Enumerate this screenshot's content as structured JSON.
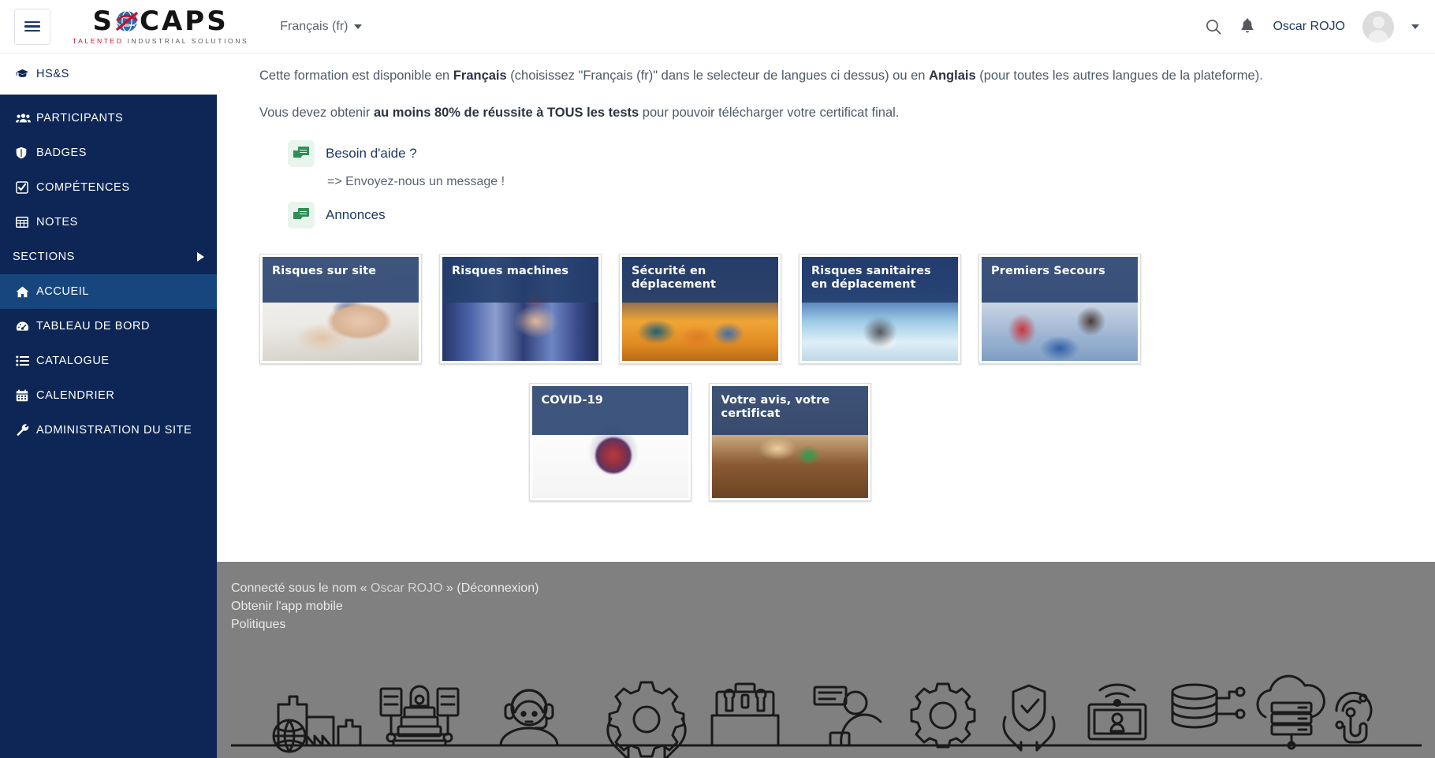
{
  "header": {
    "menu_toggle": "menu-toggle",
    "brand_word": "SOCAPS",
    "brand_letters": [
      "S",
      "C",
      "A",
      "P",
      "S"
    ],
    "tagline_red": "TALENTED",
    "tagline_rest": "INDUSTRIAL SOLUTIONS",
    "language": "Français (fr)",
    "search_icon": "search-icon",
    "notification_icon": "bell-icon",
    "user_name": "Oscar ROJO"
  },
  "sidebar": {
    "course": {
      "label": "HS&S",
      "icon": "graduation-cap-icon"
    },
    "items": [
      {
        "label": "PARTICIPANTS",
        "icon": "users-icon",
        "active": false
      },
      {
        "label": "BADGES",
        "icon": "shield-icon",
        "active": false
      },
      {
        "label": "COMPÉTENCES",
        "icon": "check-square-icon",
        "active": false
      },
      {
        "label": "NOTES",
        "icon": "table-icon",
        "active": false
      },
      {
        "label": "SECTIONS",
        "icon": "",
        "active": false,
        "expandable": true
      },
      {
        "label": "ACCUEIL",
        "icon": "home-icon",
        "active": true
      },
      {
        "label": "TABLEAU DE BORD",
        "icon": "dashboard-icon",
        "active": false
      },
      {
        "label": "CATALOGUE",
        "icon": "list-icon",
        "active": false
      },
      {
        "label": "CALENDRIER",
        "icon": "calendar-icon",
        "active": false
      },
      {
        "label": "ADMINISTRATION DU SITE",
        "icon": "wrench-icon",
        "active": false
      }
    ]
  },
  "main": {
    "paragraph1": {
      "p1": "Cette formation est disponible en ",
      "b1": "Français",
      "p2": " (choisissez \"Français (fr)\" dans le selecteur de langues ci dessus) ou en ",
      "b2": "Anglais",
      "p3": " (pour toutes les autres langues de la plateforme)."
    },
    "paragraph2": {
      "p1": "Vous devez obtenir ",
      "b1": "au moins 80% de réussite à TOUS les tests",
      "p2": " pour pouvoir télécharger votre certificat final."
    },
    "activities": [
      {
        "label": "Besoin d'aide ?",
        "icon": "forum-icon",
        "subtitle": "=> Envoyez-nous un message !"
      },
      {
        "label": "Annonces",
        "icon": "forum-icon",
        "subtitle": ""
      }
    ],
    "cards_row1": [
      {
        "title": "Risques sur site",
        "photo": "ph-site"
      },
      {
        "title": "Risques machines",
        "photo": "ph-machines"
      },
      {
        "title": "Sécurité en déplacement",
        "photo": "ph-crowd"
      },
      {
        "title": "Risques sanitaires en déplacement",
        "photo": "ph-mask"
      },
      {
        "title": "Premiers Secours",
        "photo": "ph-cpr"
      }
    ],
    "cards_row2": [
      {
        "title": "COVID-19",
        "photo": "ph-covid"
      },
      {
        "title": "Votre avis, votre certificat",
        "photo": "ph-cert"
      }
    ]
  },
  "footer": {
    "logged_prefix": "Connecté sous le nom « ",
    "logged_user": "Oscar ROJO",
    "logged_suffix": " » (",
    "logout": "Déconnexion",
    "logged_end": ")",
    "mobile_app": "Obtenir l'app mobile",
    "policies": "Politiques"
  },
  "colors": {
    "sidebar": "#0d2655",
    "sidebar_active": "#17467e",
    "card_header": "#233e6b",
    "footer": "#808080",
    "brand_red": "#c8102e",
    "link": "#1f3864",
    "activity_green": "#2f8f55"
  }
}
